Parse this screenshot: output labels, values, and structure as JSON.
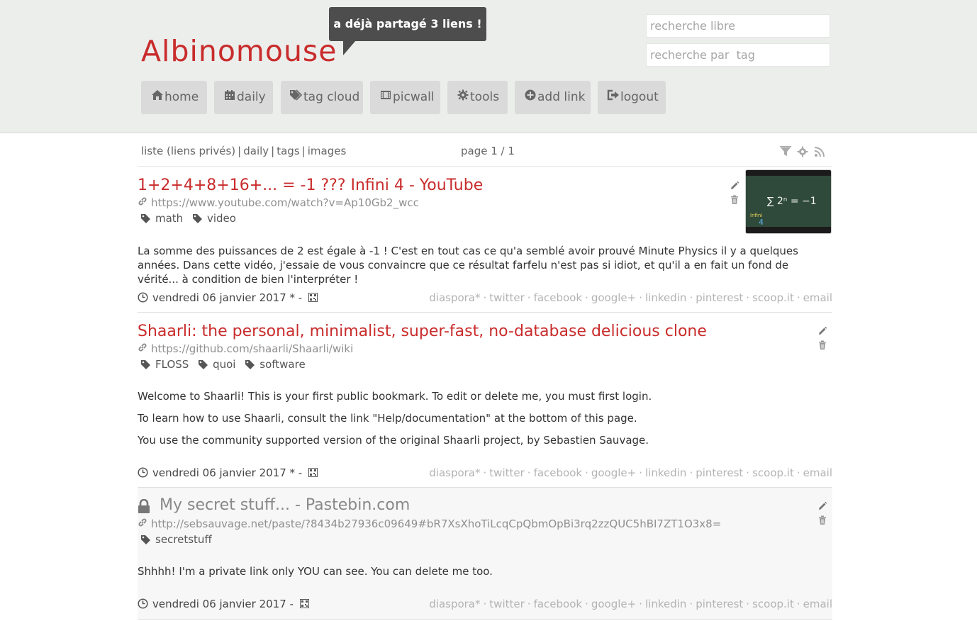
{
  "header": {
    "logo": "Albinomouse",
    "bubble": "a déjà partagé 3 liens !",
    "search_text_placeholder": "recherche libre",
    "search_tag_placeholder": "recherche par  tag",
    "nav": [
      {
        "label": "home",
        "icon": "home-icon"
      },
      {
        "label": "daily",
        "icon": "calendar-icon"
      },
      {
        "label": "tag cloud",
        "icon": "tags-icon"
      },
      {
        "label": "picwall",
        "icon": "film-icon"
      },
      {
        "label": "tools",
        "icon": "gear-icon"
      },
      {
        "label": "add link",
        "icon": "plus-circle-icon"
      },
      {
        "label": "logout",
        "icon": "sign-out-icon"
      }
    ]
  },
  "toolbar": {
    "list": "liste (liens privés)",
    "daily": "daily",
    "tags": "tags",
    "images": "images",
    "page": "page 1 / 1",
    "icons": [
      "filter-icon",
      "gear-icon",
      "rss-icon"
    ]
  },
  "share": [
    "diaspora*",
    "twitter",
    "facebook",
    "google+",
    "linkedin",
    "pinterest",
    "scoop.it",
    "email"
  ],
  "links": [
    {
      "title": "1+2+4+8+16+... = -1 ??? Infini 4 - YouTube",
      "url": "https://www.youtube.com/watch?v=Ap10Gb2_wcc",
      "tags": [
        "math",
        "video"
      ],
      "description": [
        "La somme des puissances de 2 est égale à -1 ! C'est en tout cas ce qu'a semblé avoir prouvé Minute Physics il y a quelques années. Dans cette vidéo, j'essaie de vous convaincre que ce résultat farfelu n'est pas si idiot, et qu'il a en fait un fond de vérité... à condition de bien l'interpréter !"
      ],
      "date": "vendredi 06 janvier 2017 * -",
      "private": false,
      "thumbnail": {
        "formula": "∑ 2ⁿ = −1",
        "label1": "Infini",
        "label2": "4"
      }
    },
    {
      "title": "Shaarli: the personal, minimalist, super-fast, no-database delicious clone",
      "url": "https://github.com/shaarli/Shaarli/wiki",
      "tags": [
        "FLOSS",
        "quoi",
        "software"
      ],
      "description": [
        "Welcome to Shaarli! This is your first public bookmark. To edit or delete me, you must first login.",
        "To learn how to use Shaarli, consult the link \"Help/documentation\" at the bottom of this page.",
        "You use the community supported version of the original Shaarli project, by Sebastien Sauvage."
      ],
      "date": "vendredi 06 janvier 2017 * -",
      "private": false
    },
    {
      "title": "My secret stuff... - Pastebin.com",
      "url": "http://sebsauvage.net/paste/?8434b27936c09649#bR7XsXhoTiLcqCpQbmOpBi3rq2zzQUC5hBI7ZT1O3x8=",
      "tags": [
        "secretstuff"
      ],
      "description": [
        "Shhhh! I'm a private link only YOU can see. You can delete me too."
      ],
      "date": "vendredi 06 janvier 2017 -",
      "private": true
    }
  ]
}
